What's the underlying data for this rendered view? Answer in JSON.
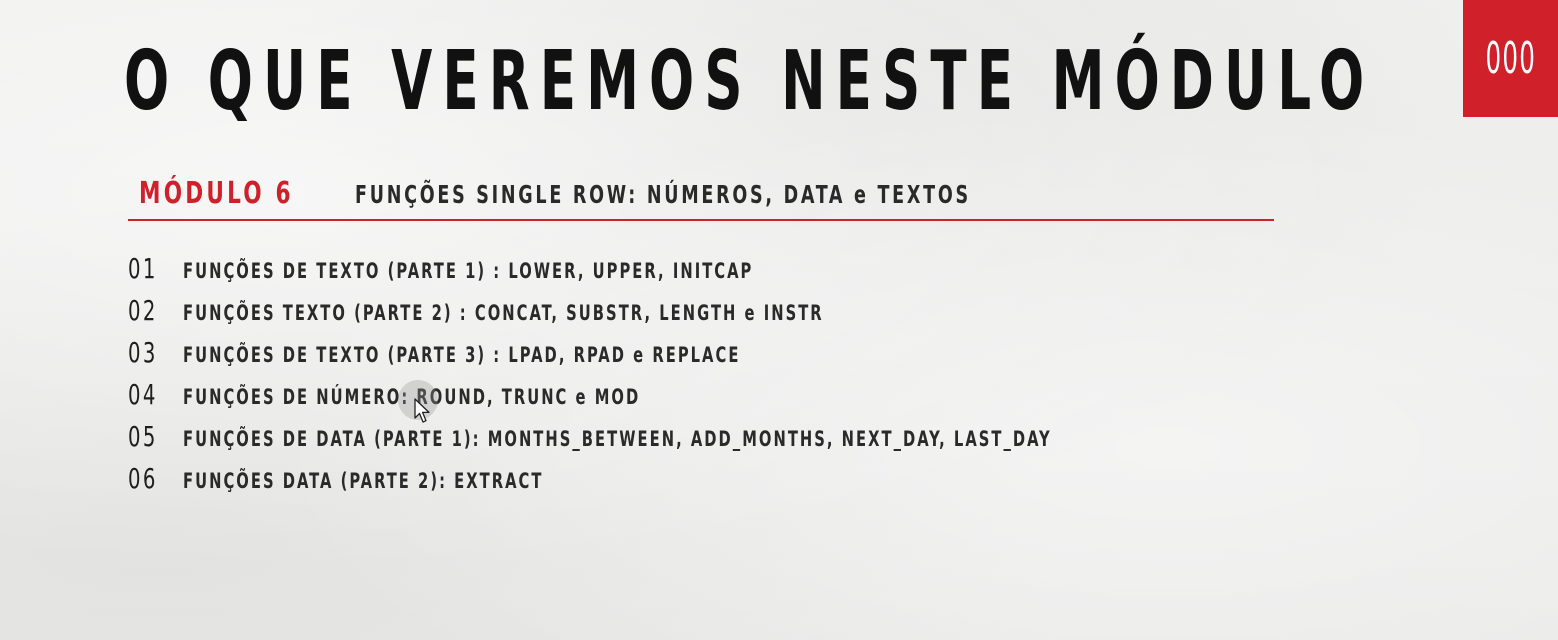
{
  "slide": {
    "title": "O QUE VEREMOS NESTE MÓDULO",
    "page_badge": "000"
  },
  "module": {
    "label": "MÓDULO 6",
    "subtitle": "FUNÇÕES SINGLE ROW: NÚMEROS, DATA e TEXTOS"
  },
  "topics": [
    {
      "number": "01",
      "text": "FUNÇÕES DE TEXTO (PARTE 1) : LOWER, UPPER, INITCAP"
    },
    {
      "number": "02",
      "text": "FUNÇÕES TEXTO (PARTE 2) : CONCAT, SUBSTR, LENGTH e INSTR"
    },
    {
      "number": "03",
      "text": "FUNÇÕES DE TEXTO (PARTE 3) : LPAD, RPAD e REPLACE"
    },
    {
      "number": "04",
      "text": "FUNÇÕES DE NÚMERO: ROUND, TRUNC e MOD"
    },
    {
      "number": "05",
      "text": "FUNÇÕES DE DATA (PARTE 1): MONTHS_BETWEEN, ADD_MONTHS, NEXT_DAY, LAST_DAY"
    },
    {
      "number": "06",
      "text": "FUNÇÕES DATA (PARTE 2): EXTRACT"
    }
  ],
  "colors": {
    "accent": "#d0202a",
    "text": "#1e1e1e",
    "background": "#ececeb"
  },
  "icons": {
    "cursor": "mouse-pointer-icon"
  }
}
